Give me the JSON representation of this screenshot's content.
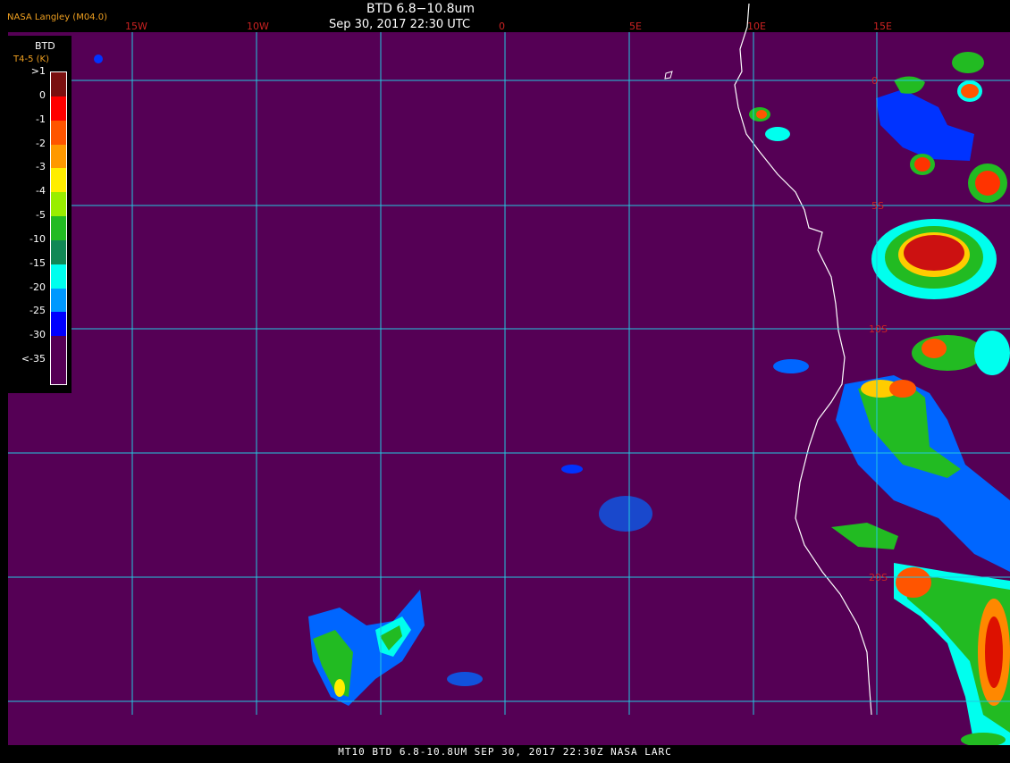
{
  "header": {
    "credit": "NASA Langley (M04.0)",
    "title": "BTD 6.8−10.8um",
    "timestamp": "Sep 30, 2017 22:30 UTC"
  },
  "footer": {
    "text": "MT10  BTD 6.8-10.8UM  SEP 30, 2017 22:30Z  NASA LARC"
  },
  "legend": {
    "title": "BTD",
    "subtitle": "T4-5 (K)",
    "entries": [
      {
        "label": ">1",
        "color": "#7a1010"
      },
      {
        "label": "0",
        "color": "#ff0000"
      },
      {
        "label": "-1",
        "color": "#ff5500"
      },
      {
        "label": "-2",
        "color": "#ff9900"
      },
      {
        "label": "-3",
        "color": "#ffee00"
      },
      {
        "label": "-4",
        "color": "#99ee00"
      },
      {
        "label": "-5",
        "color": "#22bb22"
      },
      {
        "label": "-10",
        "color": "#118855"
      },
      {
        "label": "-15",
        "color": "#00ffee"
      },
      {
        "label": "-20",
        "color": "#0099ff"
      },
      {
        "label": "-25",
        "color": "#0000ff"
      },
      {
        "label": "-30",
        "color": "#550055"
      },
      {
        "label": "<-35",
        "color": ""
      }
    ]
  },
  "map": {
    "background_color": "#550055",
    "grid_color": "#22c8e0",
    "grid_label_color": "#cc2222",
    "coastline_color": "#ffffff",
    "lon_labels": [
      "15W",
      "10W",
      "0",
      "5E",
      "10E",
      "15E"
    ],
    "lat_labels": [
      "0",
      "5S",
      "10S",
      "20S"
    ]
  },
  "colors": {
    "accent_label": "#f0a020"
  }
}
